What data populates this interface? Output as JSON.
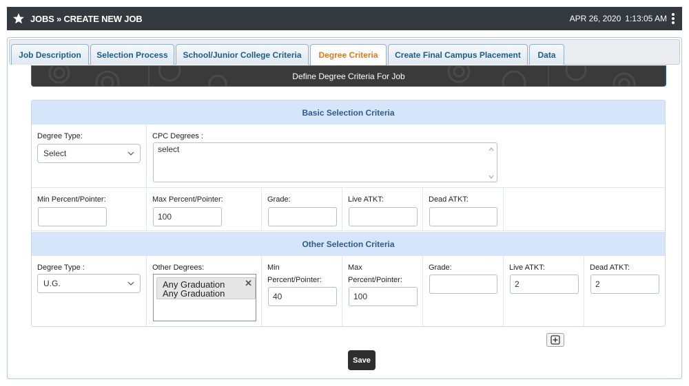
{
  "header": {
    "title": "JOBS » CREATE NEW JOB",
    "date": "APR 26, 2020",
    "time": "1:13:05 AM",
    "star_icon": "star-icon",
    "menu_icon": "kebab-menu-icon"
  },
  "tabs": [
    {
      "label": "Job Description",
      "active": false
    },
    {
      "label": "Selection Process",
      "active": false
    },
    {
      "label": "School/Junior College Criteria",
      "active": false
    },
    {
      "label": "Degree Criteria",
      "active": true
    },
    {
      "label": "Create Final Campus Placement",
      "active": false
    },
    {
      "label": "Data",
      "active": false
    }
  ],
  "banner": {
    "text": "Define Degree Criteria For Job"
  },
  "basic": {
    "heading": "Basic Selection Criteria",
    "degree_type_label": "Degree Type:",
    "degree_type_value": "Select",
    "cpc_label": "CPC Degrees :",
    "cpc_value": "select",
    "min_label": "Min Percent/Pointer:",
    "min_value": "",
    "max_label": "Max Percent/Pointer:",
    "max_value": "100",
    "grade_label": "Grade:",
    "grade_value": "",
    "live_label": "Live ATKT:",
    "live_value": "",
    "dead_label": "Dead ATKT:",
    "dead_value": ""
  },
  "other": {
    "heading": "Other Selection Criteria",
    "degree_type_label": "Degree Type :",
    "degree_type_value": "U.G.",
    "other_degrees_label": "Other Degrees:",
    "chip_line1": "Any Graduation",
    "chip_line2": "Any Graduation",
    "min_label_1": "Min",
    "min_label_2": "Percent/Pointer:",
    "min_value": "40",
    "max_label_1": "Max",
    "max_label_2": "Percent/Pointer:",
    "max_value": "100",
    "grade_label": "Grade:",
    "grade_value": "",
    "live_label": "Live ATKT:",
    "live_value": "2",
    "dead_label": "Dead ATKT:",
    "dead_value": "2"
  },
  "actions": {
    "add_icon": "plus-square-icon",
    "save_label": "Save"
  },
  "colors": {
    "topbar": "#33393f",
    "section_header": "#d6e6fa",
    "tab_text": "#1f5c8c",
    "active_tab_text": "#e07a1f",
    "save_button": "#2e2e2e"
  }
}
